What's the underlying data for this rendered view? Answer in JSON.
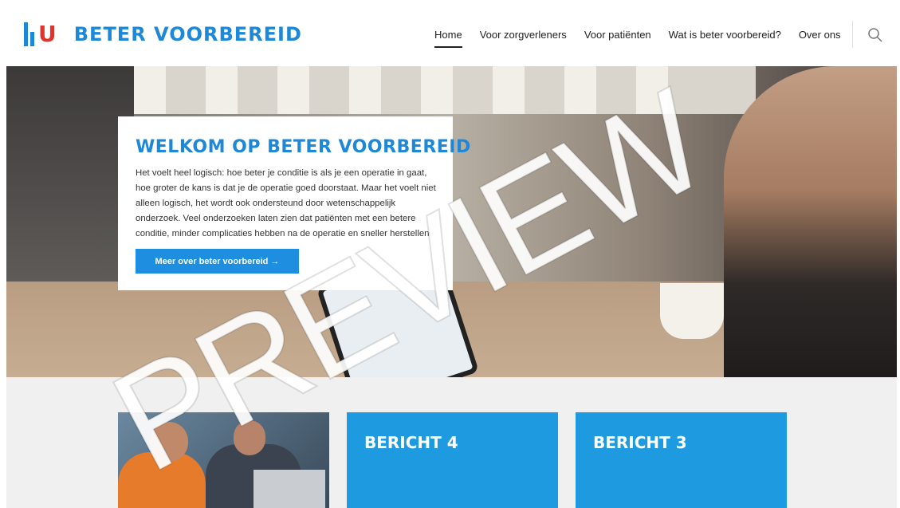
{
  "header": {
    "logo_letter": "U",
    "logo_text": "BETER VOORBEREID",
    "nav": [
      {
        "label": "Home",
        "active": true
      },
      {
        "label": "Voor zorgverleners"
      },
      {
        "label": "Voor patiënten"
      },
      {
        "label": "Wat is beter voorbereid?"
      },
      {
        "label": "Over ons"
      }
    ],
    "search_icon": "search-icon"
  },
  "hero": {
    "title": "WELKOM OP BETER VOORBEREID",
    "text": "Het voelt heel logisch: hoe beter je conditie is als je een operatie in gaat, hoe groter de kans is dat je de operatie goed doorstaat. Maar het voelt niet alleen logisch, het wordt ook ondersteund door wetenschappelijk onderzoek. Veel onderzoeken laten zien dat patiënten met een betere conditie, minder complicaties hebben na de operatie en sneller herstellen.",
    "button_label": "Meer over beter voorbereid →"
  },
  "watermark": "PREVIEW",
  "cards": [
    {
      "type": "photo"
    },
    {
      "type": "message",
      "title": "BERICHT 4"
    },
    {
      "type": "message",
      "title": "BERICHT 3"
    }
  ],
  "colors": {
    "brand_blue": "#1e88d8",
    "brand_red": "#e3322b",
    "card_blue": "#1e9be0"
  }
}
